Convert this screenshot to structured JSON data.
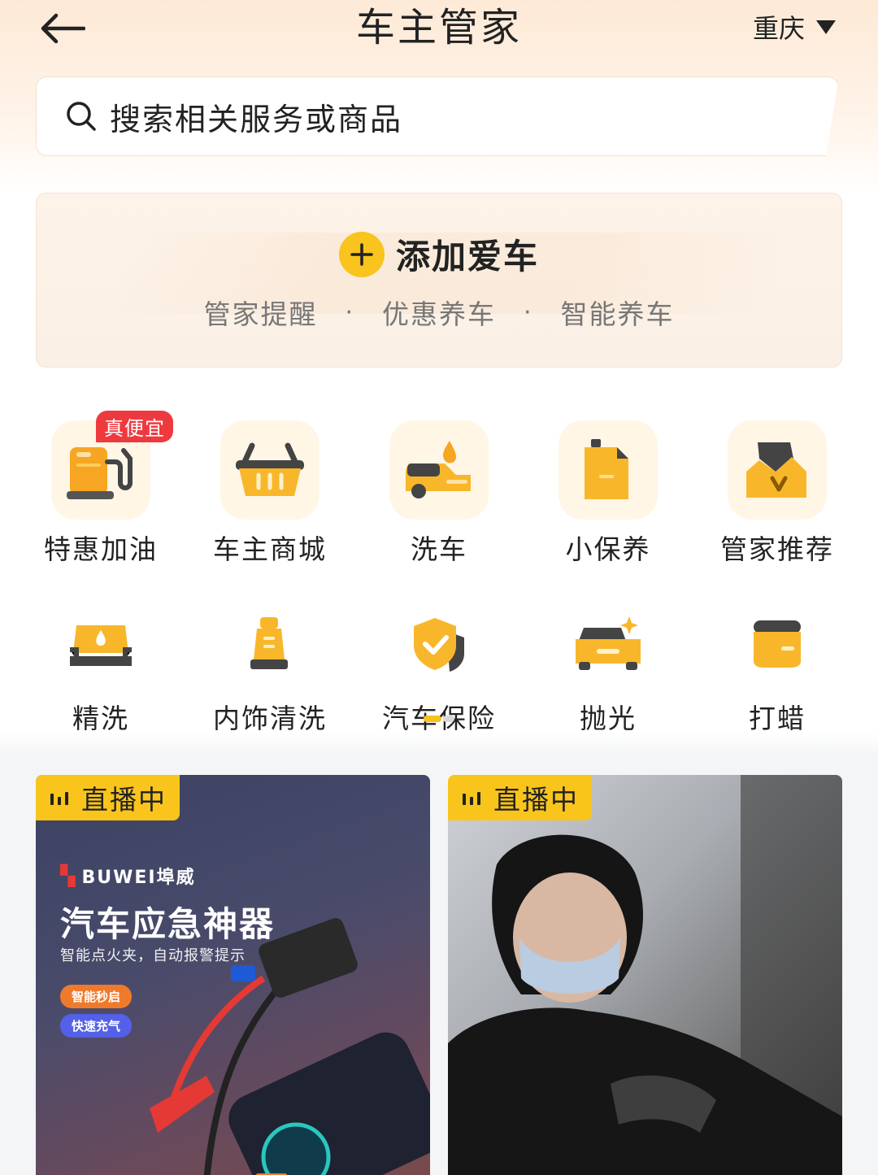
{
  "header": {
    "title": "车主管家",
    "city": "重庆"
  },
  "search": {
    "placeholder": "搜索相关服务或商品"
  },
  "add_car": {
    "label": "添加爱车",
    "features": [
      "管家提醒",
      "优惠养车",
      "智能养车"
    ]
  },
  "services": {
    "row1": [
      {
        "label": "特惠加油",
        "badge": "真便宜",
        "icon": "fuel-pump-icon"
      },
      {
        "label": "车主商城",
        "icon": "shopping-basket-icon"
      },
      {
        "label": "洗车",
        "icon": "car-wash-icon"
      },
      {
        "label": "小保养",
        "icon": "oil-can-icon"
      },
      {
        "label": "管家推荐",
        "icon": "recommend-icon"
      }
    ],
    "row2": [
      {
        "label": "精洗",
        "icon": "fine-wash-icon"
      },
      {
        "label": "内饰清洗",
        "icon": "interior-clean-icon"
      },
      {
        "label": "汽车保险",
        "icon": "shield-check-icon"
      },
      {
        "label": "抛光",
        "icon": "polish-icon"
      },
      {
        "label": "打蜡",
        "icon": "wax-icon"
      }
    ]
  },
  "live": [
    {
      "tag": "直播中",
      "brand": "BUWEI埠威",
      "title": "汽车应急神器",
      "subtitle": "智能点火夹，自动报警提示",
      "pills": [
        "智能秒启",
        "快速充气"
      ]
    },
    {
      "tag": "直播中"
    }
  ],
  "colors": {
    "accent": "#f9c51c",
    "badge": "#ee3a3f"
  }
}
